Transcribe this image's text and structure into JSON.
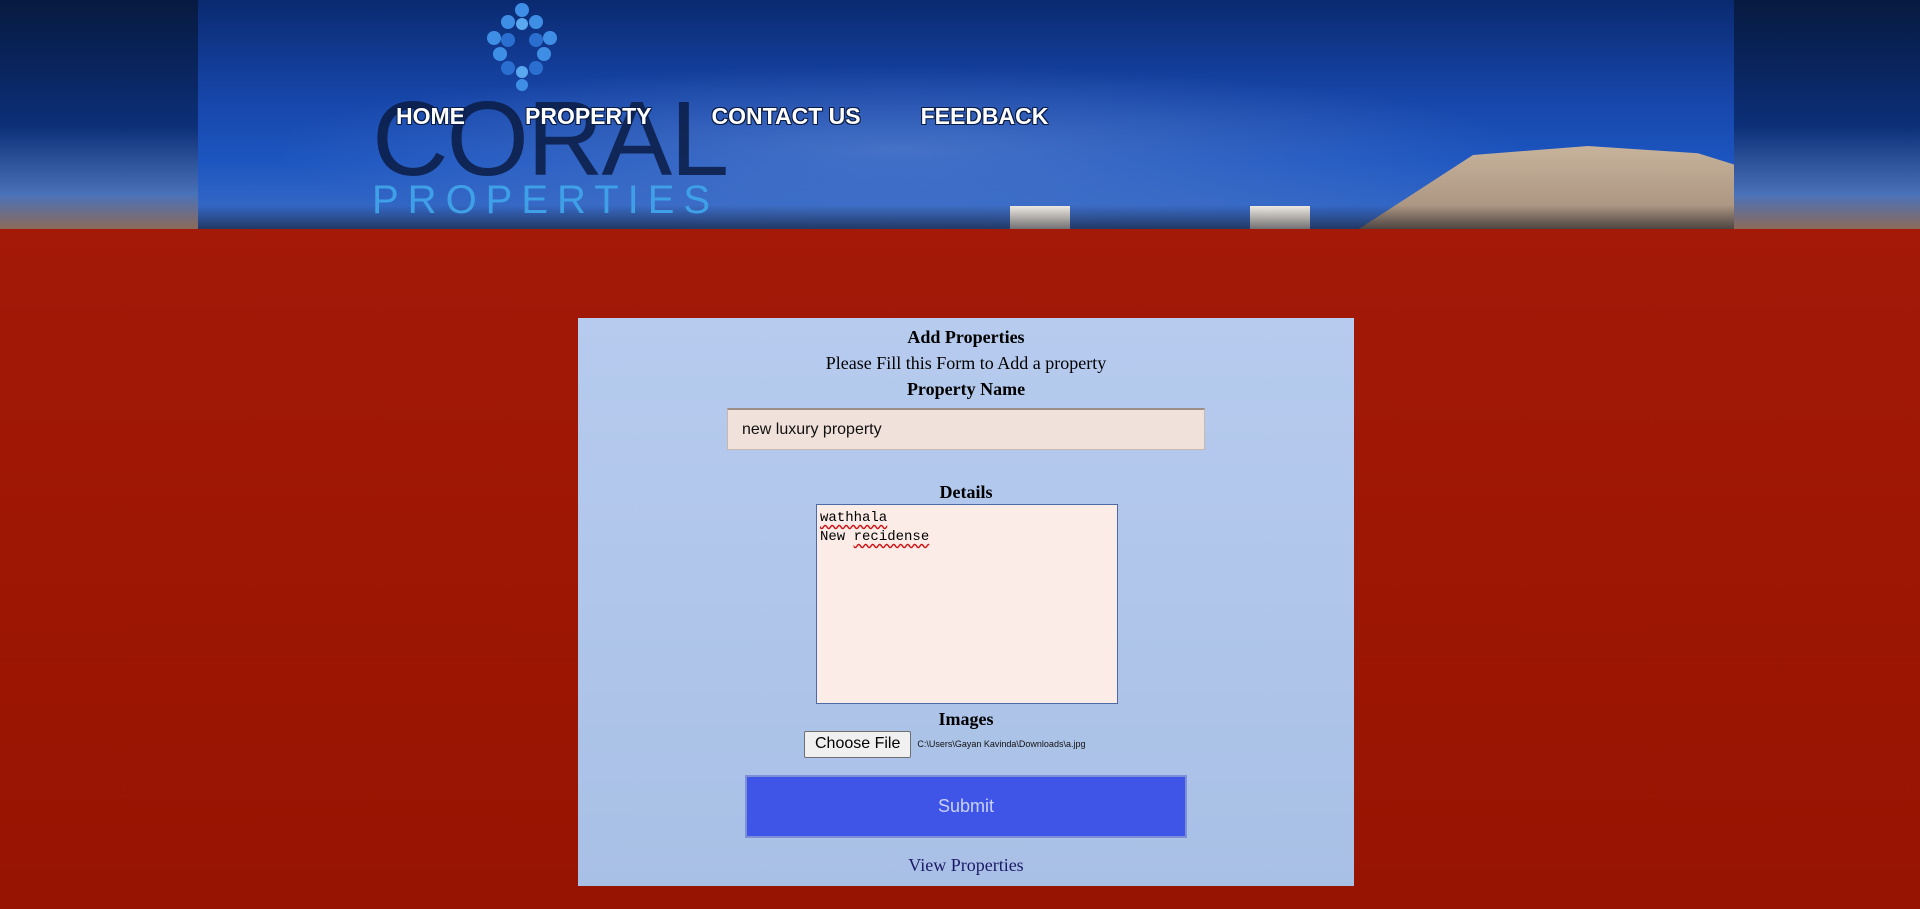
{
  "brand": {
    "name": "CORAL",
    "tagline": "PROPERTIES",
    "accent": "#3fa0e8"
  },
  "nav": {
    "items": [
      {
        "label": "HOME"
      },
      {
        "label": "PROPERTY"
      },
      {
        "label": "CONTACT US"
      },
      {
        "label": "FEEDBACK"
      }
    ]
  },
  "form": {
    "title": "Add Properties",
    "subtitle": "Please Fill this Form to Add a property",
    "property_name": {
      "label": "Property Name",
      "value": "new luxury property"
    },
    "details": {
      "label": "Details",
      "line1": "wathhala",
      "line2_prefix": "New ",
      "line2_word": "recidense"
    },
    "images": {
      "label": "Images",
      "button_label": "Choose File",
      "file_path": "C:\\Users\\Gayan Kavinda\\Downloads\\a.jpg"
    },
    "submit_label": "Submit",
    "view_link": "View Properties"
  },
  "colors": {
    "page_background": "#a01804",
    "panel_background": "#b0c6ea",
    "submit_background": "#3e55e8"
  }
}
